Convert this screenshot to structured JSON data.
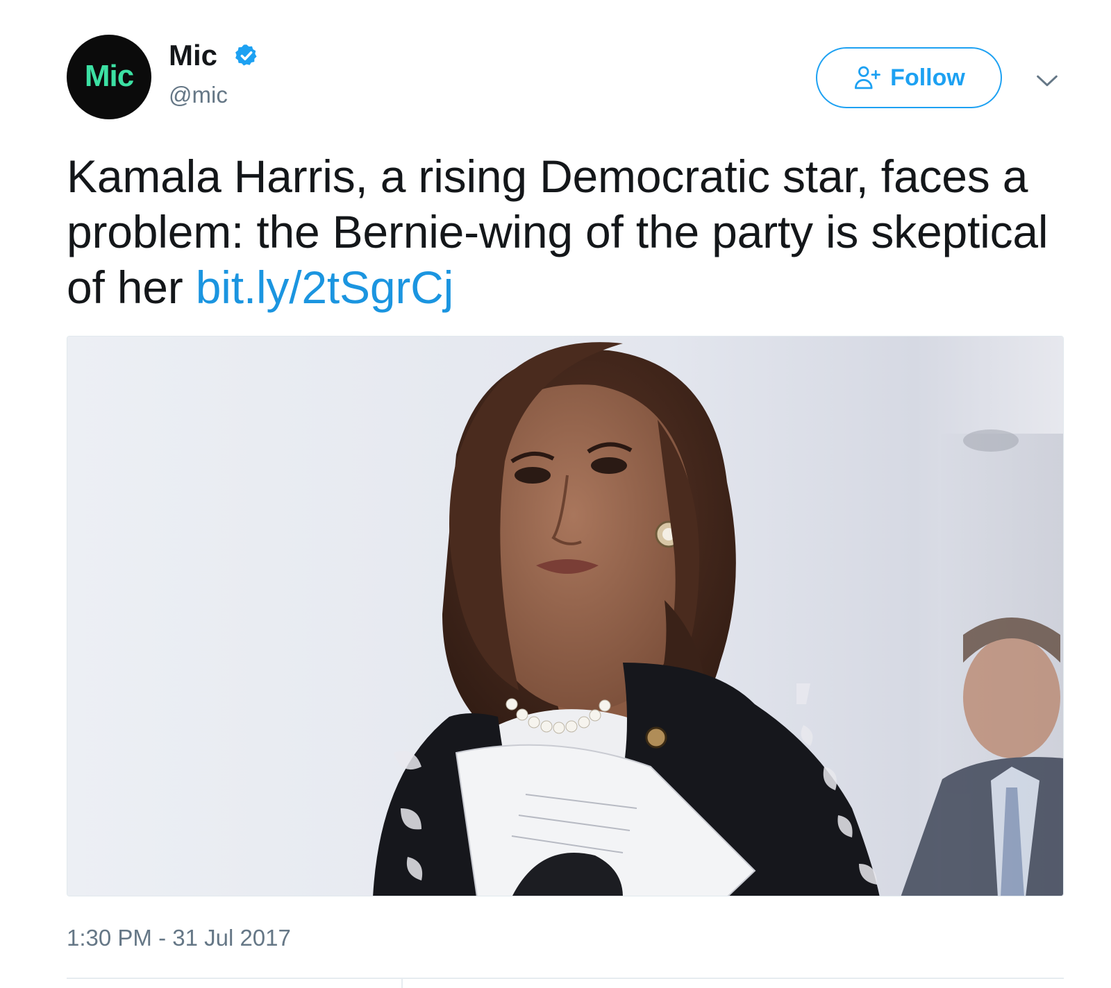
{
  "author": {
    "avatar_text": "Mic",
    "name": "Mic",
    "handle": "@mic",
    "verified": true
  },
  "actions": {
    "follow_label": "Follow",
    "follow_icon": "add-user-icon",
    "menu_icon": "chevron-down-icon"
  },
  "tweet": {
    "text": "Kamala Harris, a rising Democratic star, faces a problem: the Bernie-wing of the party is skeptical of her",
    "link": "bit.ly/2tSgrCj",
    "timestamp": "1:30 PM - 31 Jul 2017"
  },
  "colors": {
    "accent": "#1da1f2",
    "link": "#1b95e0",
    "avatar_bg": "#0b0b0b",
    "avatar_text": "#3ce0a3",
    "secondary_text": "#657786"
  }
}
